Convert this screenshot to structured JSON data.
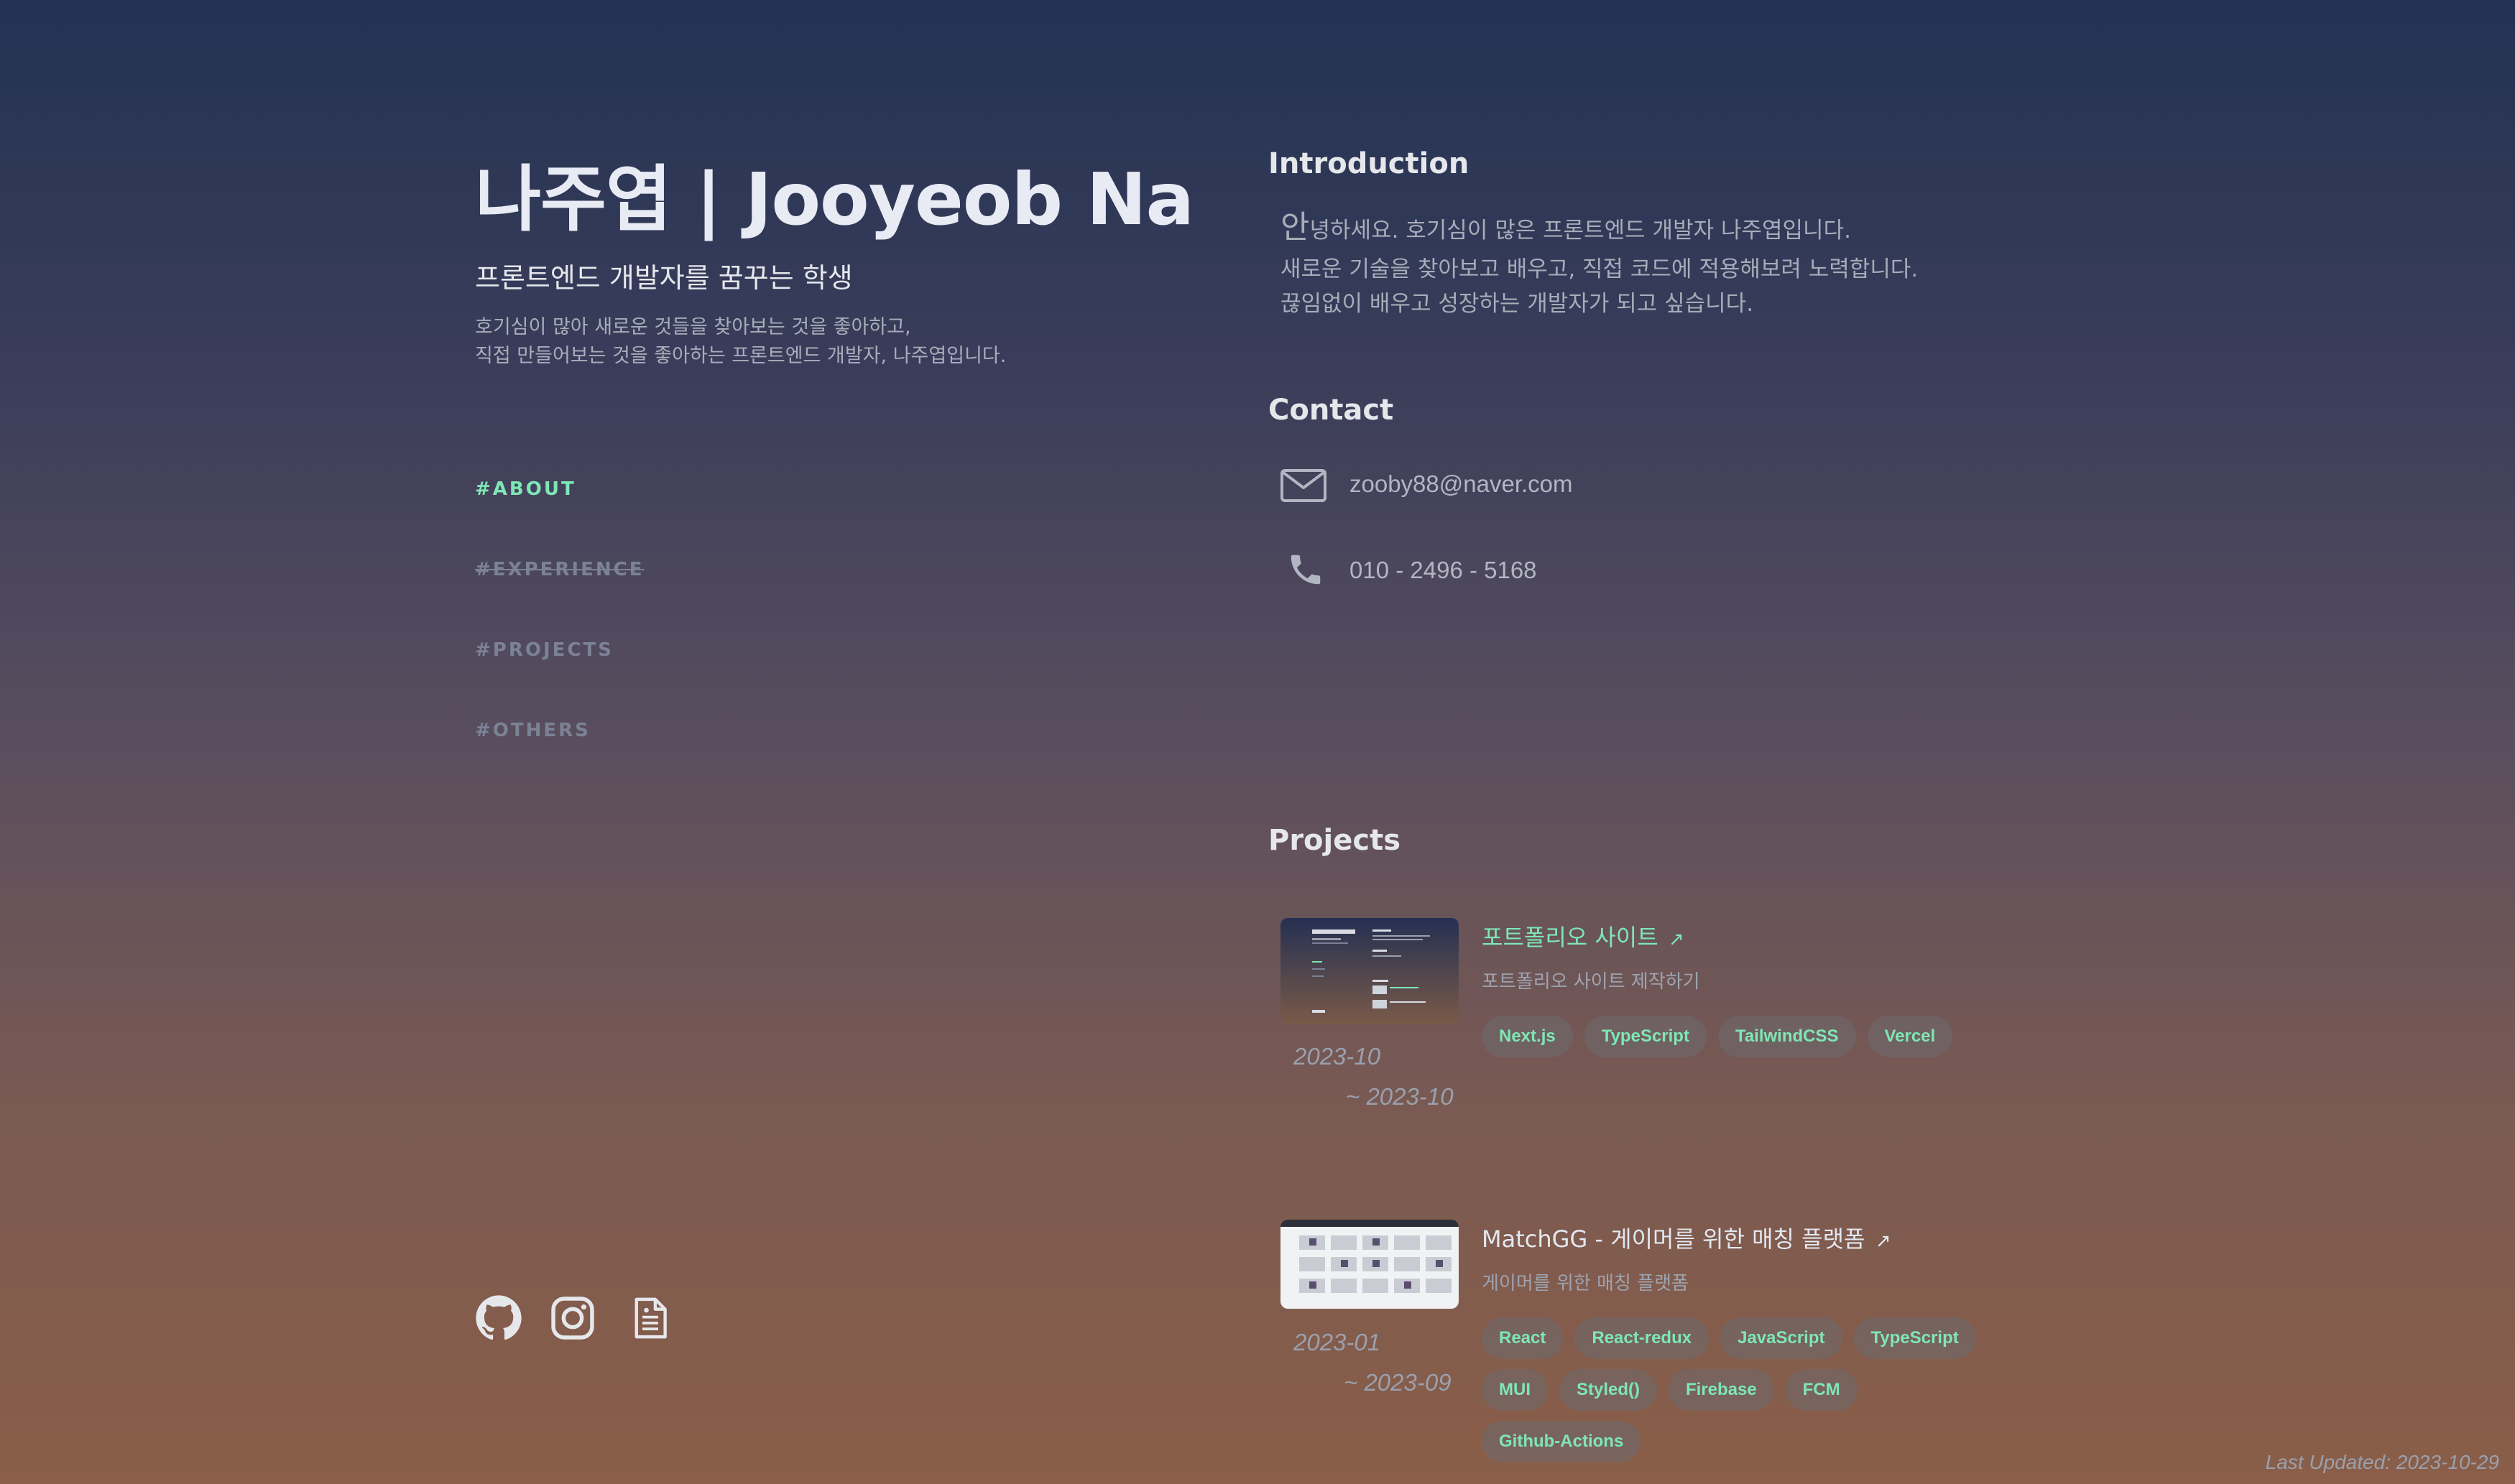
{
  "header": {
    "title": "나주엽 | Jooyeob Na",
    "subtitle": "프론트엔드 개발자를 꿈꾸는 학생",
    "description": [
      "호기심이 많아 새로운 것들을 찾아보는 것을 좋아하고,",
      "직접 만들어보는 것을 좋아하는 프론트엔드 개발자, 나주엽입니다."
    ]
  },
  "nav": [
    {
      "label": "#ABOUT",
      "state": "active"
    },
    {
      "label": "#EXPERIENCE",
      "state": "strikethrough"
    },
    {
      "label": "#PROJECTS",
      "state": "normal"
    },
    {
      "label": "#OTHERS",
      "state": "normal"
    }
  ],
  "social": [
    "github-icon",
    "instagram-icon",
    "document-icon"
  ],
  "introduction": {
    "heading": "Introduction",
    "first_char": "안",
    "line1_rest": "녕하세요. 호기심이 많은 프론트엔드 개발자 나주엽입니다.",
    "line2": "새로운 기술을 찾아보고 배우고, 직접 코드에 적용해보려 노력합니다.",
    "line3": "끊임없이 배우고 성장하는 개발자가 되고 싶습니다."
  },
  "contact": {
    "heading": "Contact",
    "email": "zooby88@naver.com",
    "phone": "010 - 2496 - 5168"
  },
  "projects": {
    "heading": "Projects",
    "items": [
      {
        "title": "포트폴리오 사이트",
        "arrow": "↗",
        "description": "포트폴리오 사이트 제작하기",
        "start": "2023-10",
        "end": "~ 2023-10",
        "tags": [
          "Next.js",
          "TypeScript",
          "TailwindCSS",
          "Vercel"
        ]
      },
      {
        "title": "MatchGG - 게이머를 위한 매칭 플랫폼",
        "arrow": "↗",
        "description": "게이머를 위한 매칭 플랫폼",
        "start": "2023-01",
        "end": "~ 2023-09",
        "tags": [
          "React",
          "React-redux",
          "JavaScript",
          "TypeScript",
          "MUI",
          "Styled()",
          "Firebase",
          "FCM",
          "Github-Actions"
        ]
      }
    ]
  },
  "footer": {
    "last_updated": "Last Updated: 2023-10-29"
  },
  "colors": {
    "accent": "#7ee7b5",
    "background_top": "#233253",
    "background_bottom": "#8a5e48"
  }
}
